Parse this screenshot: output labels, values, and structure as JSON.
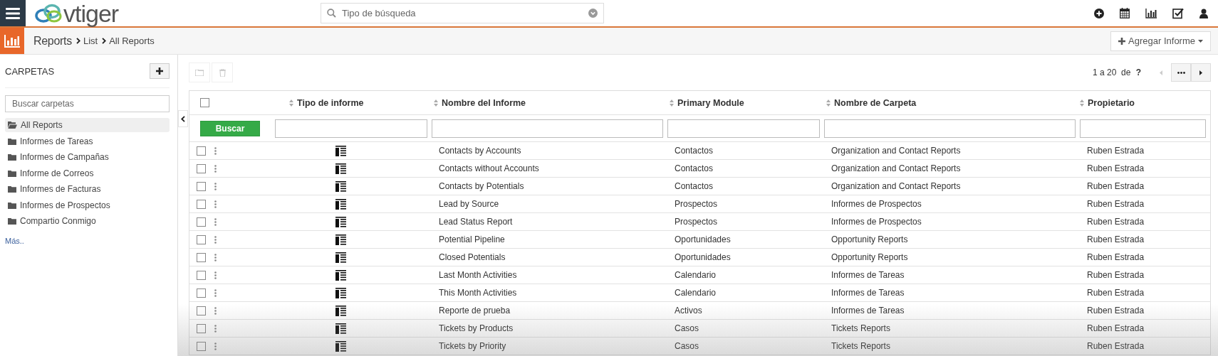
{
  "topbar": {
    "logo": "vtiger",
    "search": {
      "placeholder": "Tipo de búsqueda"
    }
  },
  "subbar": {
    "module": "Reports",
    "path": [
      "List",
      "All Reports"
    ],
    "add_button": "Agregar Informe"
  },
  "sidebar": {
    "title": "CARPETAS",
    "search": {
      "placeholder": "Buscar carpetas"
    },
    "folders": [
      {
        "label": "All Reports",
        "selected": true
      },
      {
        "label": "Informes de Tareas",
        "selected": false
      },
      {
        "label": "Informes de Campañas",
        "selected": false
      },
      {
        "label": "Informe de Correos",
        "selected": false
      },
      {
        "label": "Informes de Facturas",
        "selected": false
      },
      {
        "label": "Informes de Prospectos",
        "selected": false
      },
      {
        "label": "Compartio Conmigo",
        "selected": false
      }
    ],
    "more": "Más.."
  },
  "pagination": {
    "range": "1 a 20",
    "of": "de",
    "total": "?"
  },
  "table": {
    "filter_button": "Buscar",
    "all_checked": false,
    "columns": [
      "Tipo de informe",
      "Nombre del Informe",
      "Primary Module",
      "Nombre de Carpeta",
      "Propietario"
    ],
    "rows": [
      {
        "checked": false,
        "name": "Contacts by Accounts",
        "module": "Contactos",
        "folder": "Organization and Contact Reports",
        "owner": "Ruben Estrada"
      },
      {
        "checked": false,
        "name": "Contacts without Accounts",
        "module": "Contactos",
        "folder": "Organization and Contact Reports",
        "owner": "Ruben Estrada"
      },
      {
        "checked": false,
        "name": "Contacts by Potentials",
        "module": "Contactos",
        "folder": "Organization and Contact Reports",
        "owner": "Ruben Estrada"
      },
      {
        "checked": false,
        "name": "Lead by Source",
        "module": "Prospectos",
        "folder": "Informes de Prospectos",
        "owner": "Ruben Estrada"
      },
      {
        "checked": false,
        "name": "Lead Status Report",
        "module": "Prospectos",
        "folder": "Informes de Prospectos",
        "owner": "Ruben Estrada"
      },
      {
        "checked": false,
        "name": "Potential Pipeline",
        "module": "Oportunidades",
        "folder": "Opportunity Reports",
        "owner": "Ruben Estrada"
      },
      {
        "checked": false,
        "name": "Closed Potentials",
        "module": "Oportunidades",
        "folder": "Opportunity Reports",
        "owner": "Ruben Estrada"
      },
      {
        "checked": false,
        "name": "Last Month Activities",
        "module": "Calendario",
        "folder": "Informes de Tareas",
        "owner": "Ruben Estrada"
      },
      {
        "checked": false,
        "name": "This Month Activities",
        "module": "Calendario",
        "folder": "Informes de Tareas",
        "owner": "Ruben Estrada"
      },
      {
        "checked": false,
        "name": "Reporte de prueba",
        "module": "Activos",
        "folder": "Informes de Tareas",
        "owner": "Ruben Estrada"
      },
      {
        "checked": false,
        "name": "Tickets by Products",
        "module": "Casos",
        "folder": "Tickets Reports",
        "owner": "Ruben Estrada"
      },
      {
        "checked": false,
        "name": "Tickets by Priority",
        "module": "Casos",
        "folder": "Tickets Reports",
        "owner": "Ruben Estrada"
      }
    ]
  }
}
